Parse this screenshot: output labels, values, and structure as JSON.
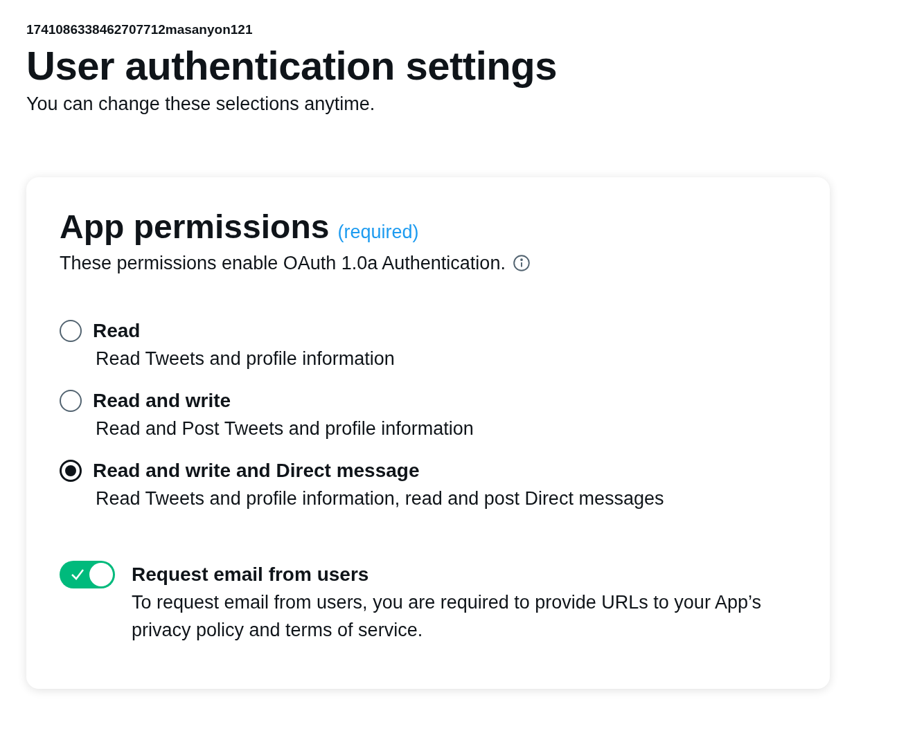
{
  "account_id": "1741086338462707712masanyon121",
  "title": "User authentication settings",
  "subtitle": "You can change these selections anytime.",
  "card": {
    "title": "App permissions",
    "required_label": "(required)",
    "description": "These permissions enable OAuth 1.0a Authentication.",
    "options": [
      {
        "label": "Read",
        "description": "Read Tweets and profile information",
        "selected": false
      },
      {
        "label": "Read and write",
        "description": "Read and Post Tweets and profile information",
        "selected": false
      },
      {
        "label": "Read and write and Direct message",
        "description": "Read Tweets and profile information, read and post Direct messages",
        "selected": true
      }
    ],
    "email_toggle": {
      "label": "Request email from users",
      "on": true,
      "description": "To request email from users, you are required to provide URLs to your App’s privacy policy and terms of service."
    }
  }
}
